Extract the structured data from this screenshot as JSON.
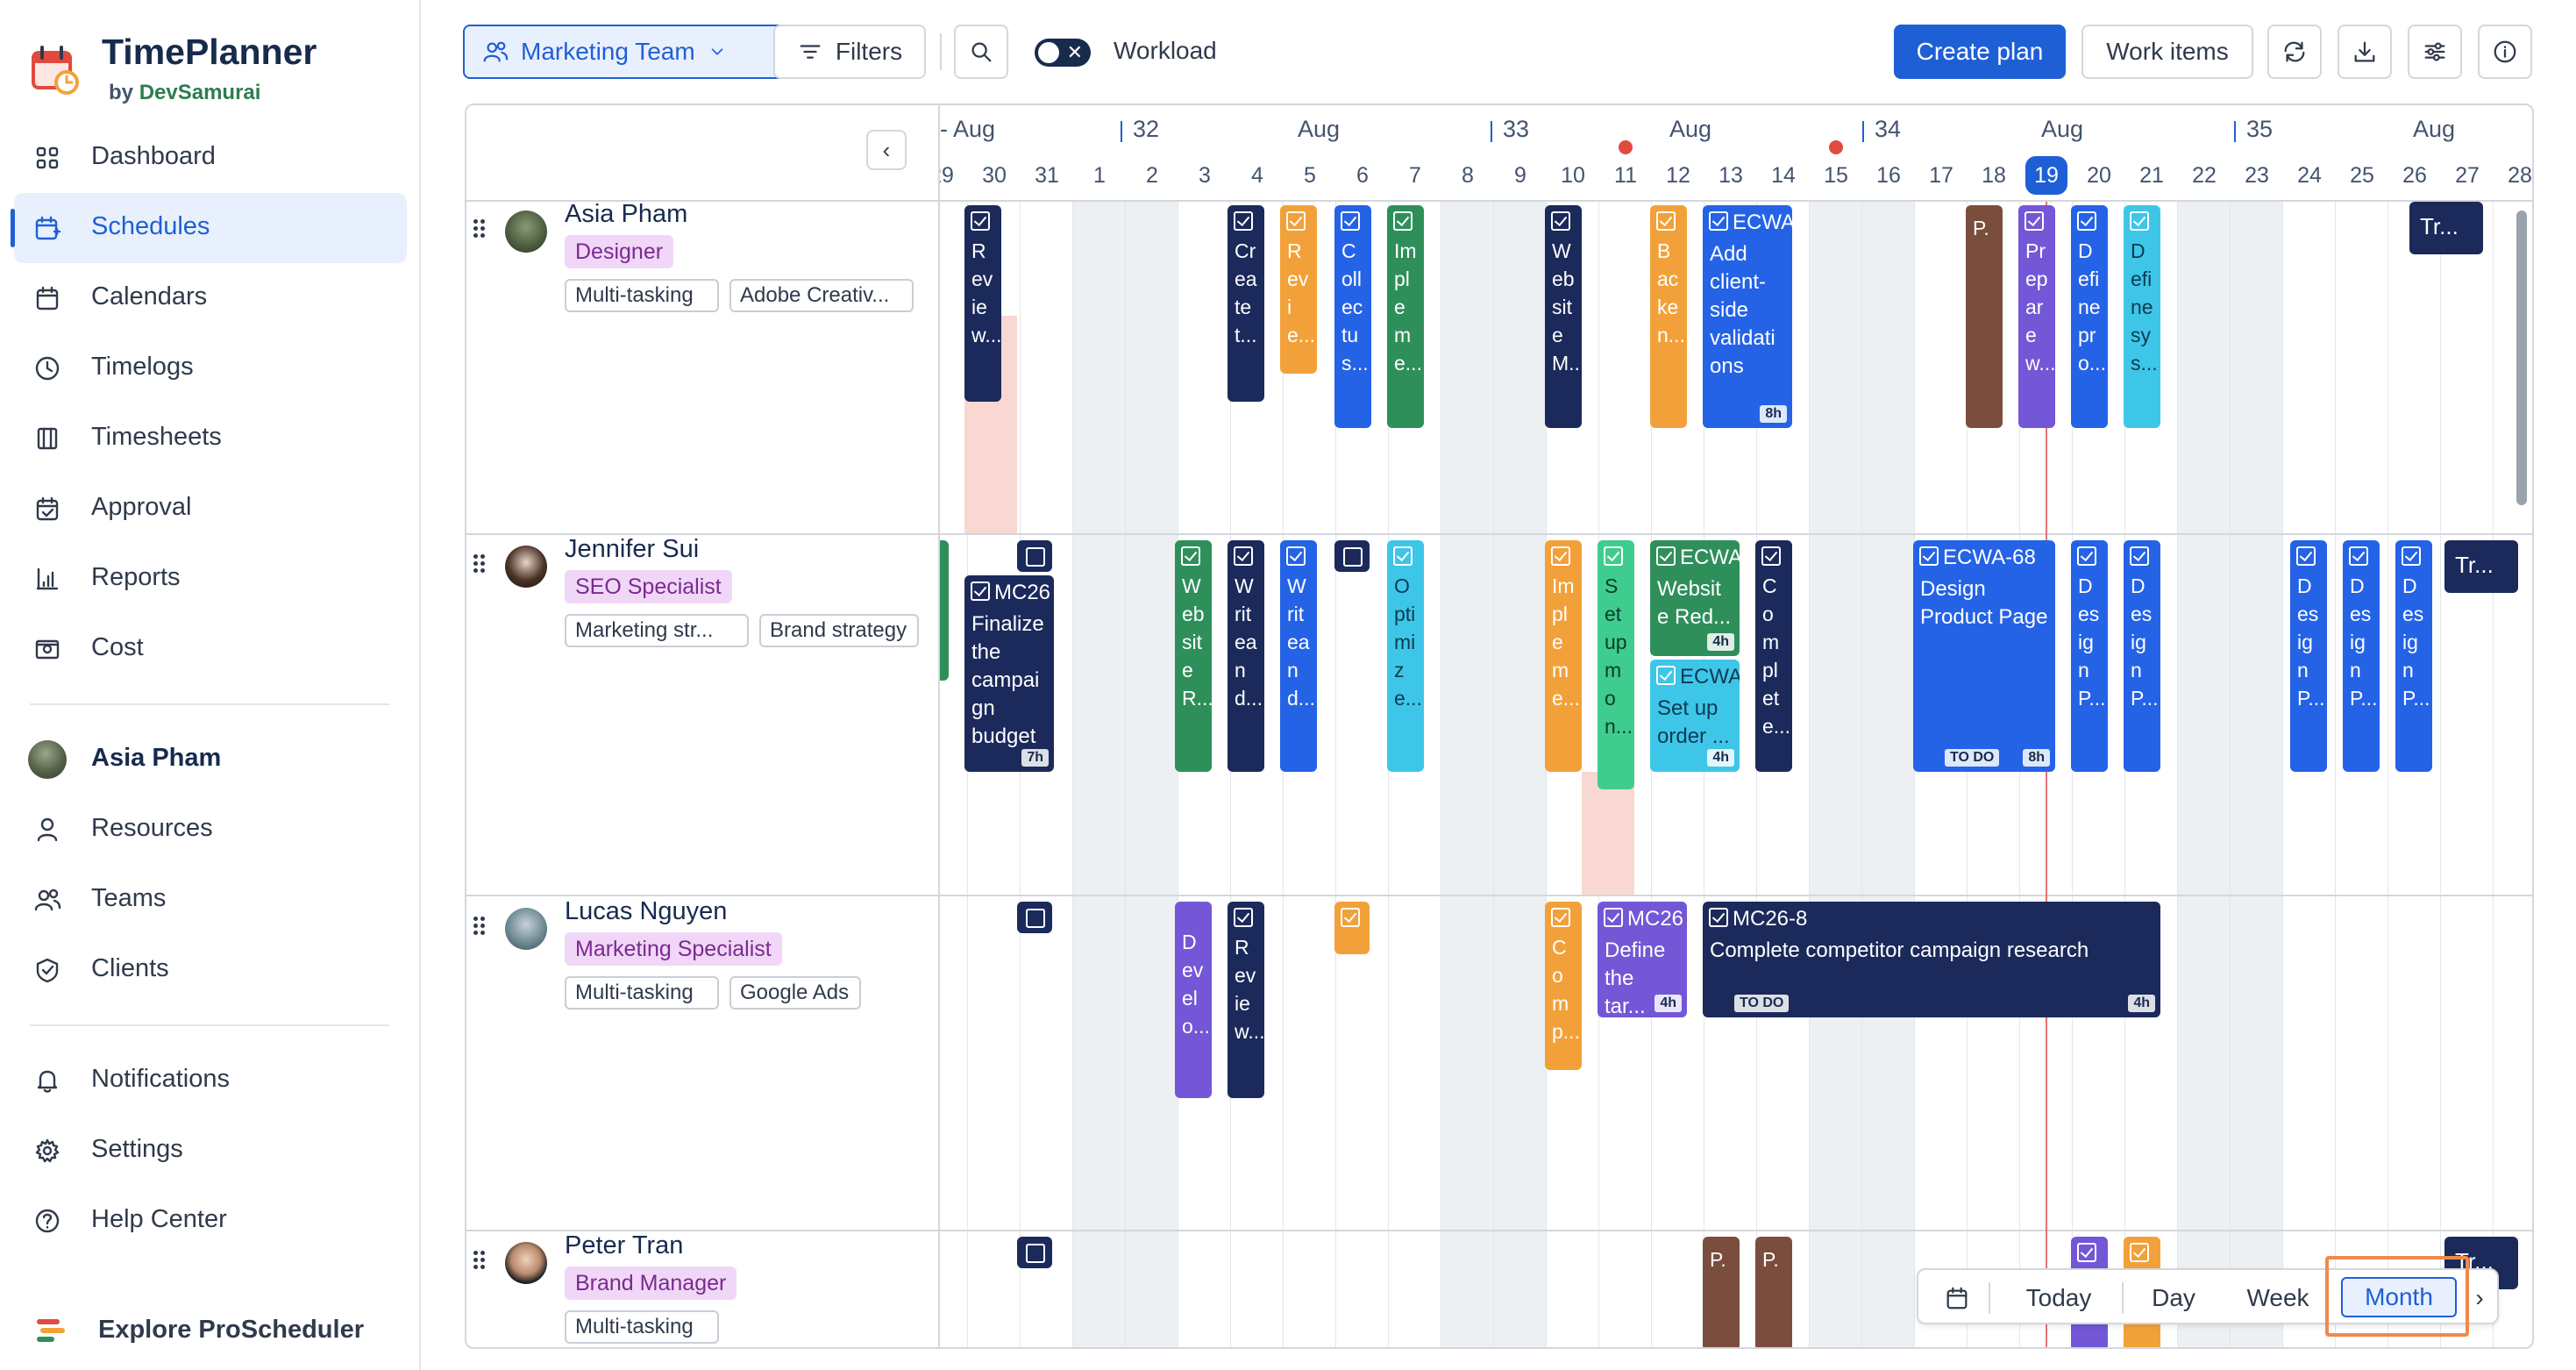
{
  "app": {
    "name": "TimePlanner",
    "by_prefix": "by",
    "by_brand": "DevSamurai"
  },
  "nav": [
    {
      "label": "Dashboard",
      "icon": "dashboard-icon"
    },
    {
      "label": "Schedules",
      "icon": "schedules-icon",
      "active": true
    },
    {
      "label": "Calendars",
      "icon": "calendar-icon"
    },
    {
      "label": "Timelogs",
      "icon": "clock-icon"
    },
    {
      "label": "Timesheets",
      "icon": "timesheet-icon"
    },
    {
      "label": "Approval",
      "icon": "approval-icon"
    },
    {
      "label": "Reports",
      "icon": "reports-icon"
    },
    {
      "label": "Cost",
      "icon": "cost-icon"
    }
  ],
  "nav2": {
    "user": "Asia Pham",
    "items": [
      {
        "label": "Resources",
        "icon": "user-icon"
      },
      {
        "label": "Teams",
        "icon": "teams-icon"
      },
      {
        "label": "Clients",
        "icon": "clients-icon"
      }
    ]
  },
  "nav3": [
    {
      "label": "Notifications",
      "icon": "bell-icon"
    },
    {
      "label": "Settings",
      "icon": "gear-icon"
    },
    {
      "label": "Help Center",
      "icon": "help-icon"
    }
  ],
  "explore": "Explore ProScheduler",
  "toolbar": {
    "team": "Marketing Team",
    "filters": "Filters",
    "workload": "Workload",
    "create_plan": "Create plan",
    "work_items": "Work items"
  },
  "timeline": {
    "weeks": [
      {
        "label": "- Aug",
        "type": "month"
      },
      {
        "label": "32",
        "type": "week"
      },
      {
        "label": "Aug",
        "type": "month"
      },
      {
        "label": "33",
        "type": "week"
      },
      {
        "label": "Aug",
        "type": "month"
      },
      {
        "label": "34",
        "type": "week"
      },
      {
        "label": "Aug",
        "type": "month"
      },
      {
        "label": "35",
        "type": "week"
      },
      {
        "label": "Aug",
        "type": "month"
      }
    ],
    "days": [
      "29",
      "30",
      "31",
      "1",
      "2",
      "3",
      "4",
      "5",
      "6",
      "7",
      "8",
      "9",
      "10",
      "11",
      "12",
      "13",
      "14",
      "15",
      "16",
      "17",
      "18",
      "19",
      "20",
      "21",
      "22",
      "23",
      "24",
      "25",
      "26",
      "27",
      "28"
    ],
    "weekend_days": [
      "1",
      "2",
      "8",
      "9",
      "15",
      "16",
      "22",
      "23"
    ],
    "today": "19"
  },
  "people": [
    {
      "name": "Asia Pham",
      "role": "Designer",
      "skills": [
        "Multi-tasking",
        "Adobe Creativ..."
      ]
    },
    {
      "name": "Jennifer Sui",
      "role": "SEO Specialist",
      "skills": [
        "Marketing str...",
        "Brand strategy"
      ]
    },
    {
      "name": "Lucas Nguyen",
      "role": "Marketing Specialist",
      "skills": [
        "Multi-tasking",
        "Google Ads"
      ]
    },
    {
      "name": "Peter Tran",
      "role": "Brand Manager",
      "skills": [
        "Multi-tasking"
      ]
    }
  ],
  "tasks": {
    "asia_ecwa_key": "ECWA",
    "asia_ecwa_title": "Add client-side validations",
    "asia_ecwa_est": "8h",
    "jen_mc26_key": "MC26",
    "jen_mc26_title": "Finalize the campaign budget",
    "jen_mc26_est": "7h",
    "jen_ecwa1_key": "ECWA",
    "jen_ecwa1_title": "Website Red...",
    "jen_ecwa1_est": "4h",
    "jen_ecwa2_key": "ECWA",
    "jen_ecwa2_title": "Set up order ...",
    "jen_ecwa2_est": "4h",
    "jen_ecwa68_key": "ECWA-68",
    "jen_ecwa68_title": "Design Product Page",
    "jen_ecwa68_status": "TO DO",
    "jen_ecwa68_est": "8h",
    "lucas_mc26_key": "MC26",
    "lucas_mc26_title": "Define the tar...",
    "lucas_mc26_est": "4h",
    "lucas_mc268_key": "MC26-8",
    "lucas_mc268_title": "Complete competitor campaign research",
    "lucas_mc268_status": "TO DO",
    "lucas_mc268_est": "4h",
    "plan_label": "Tr..."
  },
  "view_switch": {
    "today": "Today",
    "day": "Day",
    "week": "Week",
    "month": "Month",
    "active": "Month"
  }
}
